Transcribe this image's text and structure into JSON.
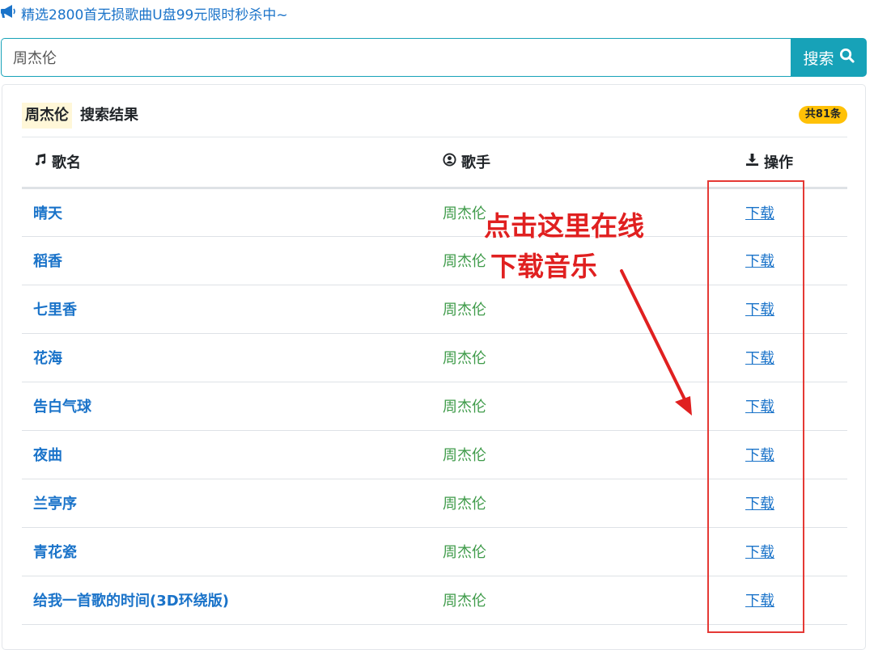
{
  "promo": {
    "text": "精选2800首无损歌曲U盘99元限时秒杀中~",
    "icon": "bullhorn-icon",
    "color": "#1a73c9"
  },
  "search": {
    "value": "周杰伦",
    "placeholder": "",
    "button_label": "搜索",
    "accent": "#17a2b8"
  },
  "results": {
    "keyword": "周杰伦",
    "label": "搜索结果",
    "count_badge": "共81条",
    "columns": {
      "song": "歌名",
      "singer": "歌手",
      "action": "操作"
    },
    "rows": [
      {
        "song": "晴天",
        "singer": "周杰伦",
        "action": "下载"
      },
      {
        "song": "稻香",
        "singer": "周杰伦",
        "action": "下载"
      },
      {
        "song": "七里香",
        "singer": "周杰伦",
        "action": "下载"
      },
      {
        "song": "花海",
        "singer": "周杰伦",
        "action": "下载"
      },
      {
        "song": "告白气球",
        "singer": "周杰伦",
        "action": "下载"
      },
      {
        "song": "夜曲",
        "singer": "周杰伦",
        "action": "下载"
      },
      {
        "song": "兰亭序",
        "singer": "周杰伦",
        "action": "下载"
      },
      {
        "song": "青花瓷",
        "singer": "周杰伦",
        "action": "下载"
      },
      {
        "song": "给我一首歌的时间(3D环绕版)",
        "singer": "周杰伦",
        "action": "下载"
      }
    ]
  },
  "annotation": {
    "line1": "点击这里在线",
    "line2": "下载音乐",
    "color": "#e02020"
  }
}
